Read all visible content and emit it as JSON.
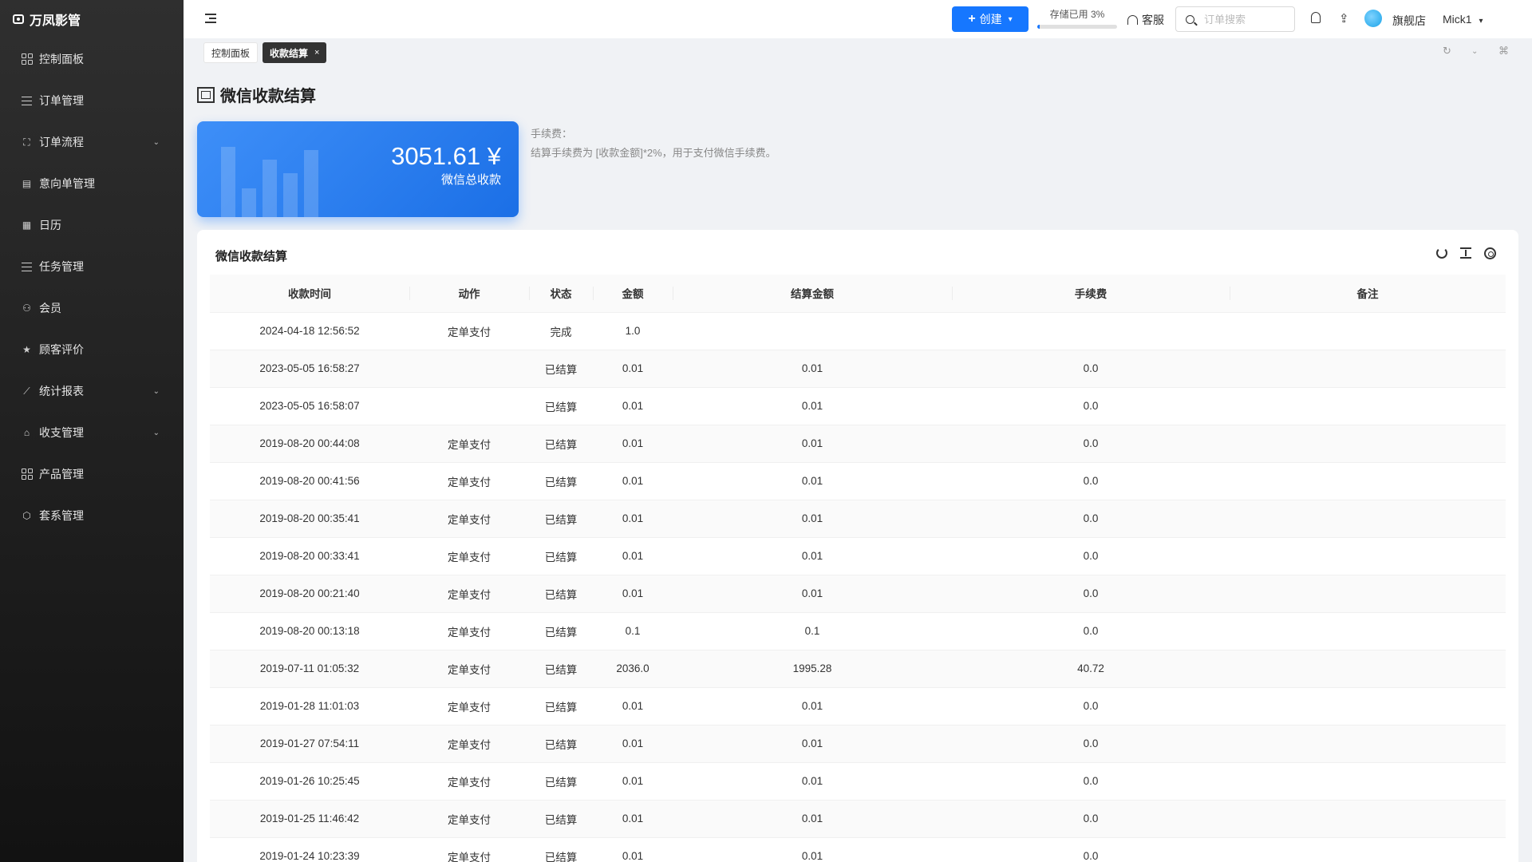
{
  "app": {
    "name": "万凤影管"
  },
  "sidebar": {
    "items": [
      {
        "label": "控制面板",
        "icon": "dashboard-icon",
        "has_children": false
      },
      {
        "label": "订单管理",
        "icon": "list-icon",
        "has_children": false
      },
      {
        "label": "订单流程",
        "icon": "flow-icon",
        "has_children": true
      },
      {
        "label": "意向单管理",
        "icon": "document-icon",
        "has_children": false
      },
      {
        "label": "日历",
        "icon": "calendar-icon",
        "has_children": false
      },
      {
        "label": "任务管理",
        "icon": "task-icon",
        "has_children": false
      },
      {
        "label": "会员",
        "icon": "user-icon",
        "has_children": false
      },
      {
        "label": "顾客评价",
        "icon": "star-icon",
        "has_children": false
      },
      {
        "label": "统计报表",
        "icon": "chart-icon",
        "has_children": true
      },
      {
        "label": "收支管理",
        "icon": "bank-icon",
        "has_children": true
      },
      {
        "label": "产品管理",
        "icon": "product-icon",
        "has_children": false
      },
      {
        "label": "套系管理",
        "icon": "package-icon",
        "has_children": false
      }
    ]
  },
  "header": {
    "create_label": "创建",
    "storage_label": "存储已用 3%",
    "storage_percent": 3,
    "service_label": "客服",
    "search_placeholder": "订单搜索",
    "shop_name": "旗舰店",
    "user_name": "Mick1"
  },
  "tabs": [
    {
      "label": "控制面板",
      "active": false
    },
    {
      "label": "收款结算",
      "active": true,
      "close": "×"
    }
  ],
  "page": {
    "title": "微信收款结算",
    "stat_amount": "3051.61 ¥",
    "stat_label": "微信总收款",
    "fee_title": "手续费：",
    "fee_desc": "结算手续费为 [收款金额]*2%，用于支付微信手续费。"
  },
  "table": {
    "title": "微信收款结算",
    "columns": [
      "收款时间",
      "动作",
      "状态",
      "金额",
      "结算金额",
      "手续费",
      "备注"
    ],
    "rows": [
      [
        "2024-04-18 12:56:52",
        "定单支付",
        "完成",
        "1.0",
        "",
        "",
        ""
      ],
      [
        "2023-05-05 16:58:27",
        "",
        "已结算",
        "0.01",
        "0.01",
        "0.0",
        ""
      ],
      [
        "2023-05-05 16:58:07",
        "",
        "已结算",
        "0.01",
        "0.01",
        "0.0",
        ""
      ],
      [
        "2019-08-20 00:44:08",
        "定单支付",
        "已结算",
        "0.01",
        "0.01",
        "0.0",
        ""
      ],
      [
        "2019-08-20 00:41:56",
        "定单支付",
        "已结算",
        "0.01",
        "0.01",
        "0.0",
        ""
      ],
      [
        "2019-08-20 00:35:41",
        "定单支付",
        "已结算",
        "0.01",
        "0.01",
        "0.0",
        ""
      ],
      [
        "2019-08-20 00:33:41",
        "定单支付",
        "已结算",
        "0.01",
        "0.01",
        "0.0",
        ""
      ],
      [
        "2019-08-20 00:21:40",
        "定单支付",
        "已结算",
        "0.01",
        "0.01",
        "0.0",
        ""
      ],
      [
        "2019-08-20 00:13:18",
        "定单支付",
        "已结算",
        "0.1",
        "0.1",
        "0.0",
        ""
      ],
      [
        "2019-07-11 01:05:32",
        "定单支付",
        "已结算",
        "2036.0",
        "1995.28",
        "40.72",
        ""
      ],
      [
        "2019-01-28 11:01:03",
        "定单支付",
        "已结算",
        "0.01",
        "0.01",
        "0.0",
        ""
      ],
      [
        "2019-01-27 07:54:11",
        "定单支付",
        "已结算",
        "0.01",
        "0.01",
        "0.0",
        ""
      ],
      [
        "2019-01-26 10:25:45",
        "定单支付",
        "已结算",
        "0.01",
        "0.01",
        "0.0",
        ""
      ],
      [
        "2019-01-25 11:46:42",
        "定单支付",
        "已结算",
        "0.01",
        "0.01",
        "0.0",
        ""
      ],
      [
        "2019-01-24 10:23:39",
        "定单支付",
        "已结算",
        "0.01",
        "0.01",
        "0.0",
        ""
      ]
    ]
  },
  "colors": {
    "accent": "#1677ff",
    "sidebar_bg": "#262626"
  }
}
